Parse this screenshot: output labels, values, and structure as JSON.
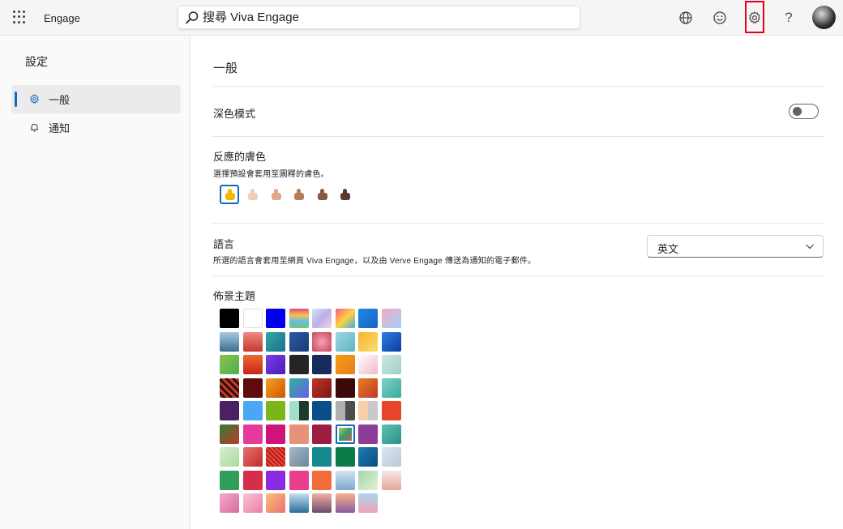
{
  "app": {
    "title": "Engage"
  },
  "search": {
    "placeholder": "搜尋 Viva Engage"
  },
  "topbar": {
    "help_label": "?"
  },
  "sidebar": {
    "title": "設定",
    "items": [
      {
        "label": "一般",
        "icon": "gear-icon",
        "active": true
      },
      {
        "label": "通知",
        "icon": "bell-icon",
        "active": false
      }
    ]
  },
  "main": {
    "title": "一般",
    "dark_mode": {
      "label": "深色模式",
      "on": false
    },
    "skin_tone": {
      "label": "反應的膚色",
      "description": "選擇預設會套用至圖釋的膚色。",
      "tones": [
        "#f5b800",
        "#f2cdb8",
        "#e0a98a",
        "#b57c5a",
        "#8a5a40",
        "#5a3a2c"
      ],
      "selected": 0
    },
    "language": {
      "label": "語言",
      "description": "所選的語言會套用至網頁 Viva Engage，以及由 Verve Engage 傳送為通知的電子郵件。",
      "value": "英文"
    },
    "themes": {
      "label": "佈景主題",
      "selected": 45,
      "swatches": [
        "#000000",
        "#ffffff",
        "#0000ee",
        "linear-gradient(180deg,#e34a7a,#f9c04a,#5cc0e8,#7dc36b)",
        "linear-gradient(135deg,#d7e7f5,#b9b0e6,#f2d2e6)",
        "linear-gradient(135deg,#f45d8a,#ffd23f,#3ab0e2)",
        "linear-gradient(135deg,#1e88e5,#1565c0)",
        "linear-gradient(135deg,#f7a8c4,#9fd2f5)",
        "linear-gradient(180deg,#a8c8e0,#3d6e8f)",
        "linear-gradient(180deg,#f08a80,#c0392b)",
        "linear-gradient(135deg,#2ea8a4,#1f6f8b)",
        "linear-gradient(135deg,#2b5aa6,#173a78)",
        "radial-gradient(circle,#f4a3b5,#c8435b)",
        "linear-gradient(135deg,#9fd7e0,#5fb3c4)",
        "linear-gradient(135deg,#f9b233,#f7e06a)",
        "linear-gradient(135deg,#2f7ee0,#0a3d9e)",
        "linear-gradient(135deg,#8bc34a,#4caf50)",
        "linear-gradient(180deg,#f06a2e,#c4261d)",
        "linear-gradient(135deg,#7a3ee8,#4a1cb5)",
        "#252525",
        "#172b5c",
        "linear-gradient(135deg,#f39c12,#e67e22)",
        "linear-gradient(135deg,#ffffff,#f2b8c6)",
        "linear-gradient(135deg,#cfe8e3,#9fd0c6)",
        "repeating-linear-gradient(45deg,#c0392b 0 3px,#2a0a0a 3px 6px)",
        "#5e0b0b",
        "linear-gradient(135deg,#f3a324,#d35400)",
        "linear-gradient(135deg,#2bb5a0,#6c5ce7)",
        "linear-gradient(135deg,#c0392b,#7a1212)",
        "#3d0808",
        "linear-gradient(135deg,#e67e22,#c0392b)",
        "linear-gradient(135deg,#7fd1c7,#3aa99b)",
        "#4b2163",
        "#4aa7f5",
        "#7cb518",
        "linear-gradient(90deg,#9fe0c8 50%,#1e3a2e 50%)",
        "#0b4f8a",
        "linear-gradient(90deg,#b0b0b0 50%,#4d4d4d 50%)",
        "linear-gradient(90deg,#f5d0a9 50%,#c9c9c9 50%)",
        "#e8462b",
        "linear-gradient(135deg,#2e7d32,#c0392b)",
        "#e23b9a",
        "#d0137b",
        "#e8917a",
        "#9c1c44",
        "linear-gradient(135deg,#f7c948,#2f9e6e,#e84a5f)",
        "#8e3c9a",
        "linear-gradient(135deg,#5fc2b9,#2a8f86)",
        "linear-gradient(135deg,#d8f0d0,#a7d99a)",
        "linear-gradient(135deg,#e57373,#c62828)",
        "repeating-linear-gradient(45deg,#e84a3a 0 2px,#b71c1c 2px 4px)",
        "linear-gradient(135deg,#a9b9c9,#6c8499)",
        "#14898f",
        "#0d7a4a",
        "linear-gradient(135deg,#1f7ab8,#0e4d7a)",
        "linear-gradient(135deg,#dde6ee,#b7c8d8)",
        "#2e9e5a",
        "#d62d4a",
        "#8a2be2",
        "#e83e8c",
        "#f26b3a",
        "linear-gradient(180deg,#cfe3f3,#7ea8c9)",
        "linear-gradient(135deg,#9dd7b3,#e8f1d0)",
        "linear-gradient(180deg,#f3e9e3,#e8a59b)",
        "linear-gradient(135deg,#f5a9c8,#d56c9e)",
        "linear-gradient(135deg,#f7c5d5,#e97da4)",
        "linear-gradient(135deg,#f9c07a,#ee6f6f)",
        "linear-gradient(180deg,#bfe1f3,#2b6c9a)",
        "linear-gradient(180deg,#f2b1a0,#6b4b6e)",
        "linear-gradient(180deg,#f5b48a,#8c5aa0)",
        "linear-gradient(180deg,#a7d6f0,#f1a3b7)"
      ]
    }
  }
}
